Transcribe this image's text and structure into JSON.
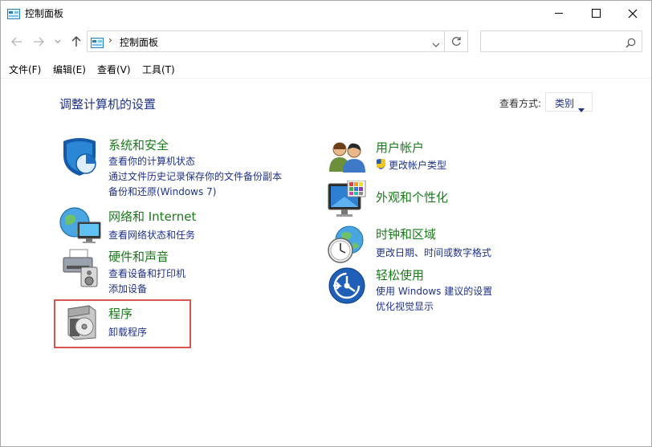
{
  "window": {
    "title": "控制面板",
    "controls": {
      "minimize": "—",
      "maximize": "☐",
      "close": "✕"
    }
  },
  "address": {
    "separator": "›",
    "path": "控制面板",
    "search_placeholder": ""
  },
  "menu": [
    {
      "label": "文件(F)"
    },
    {
      "label": "编辑(E)"
    },
    {
      "label": "查看(V)"
    },
    {
      "label": "工具(T)"
    }
  ],
  "main": {
    "heading": "调整计算机的设置",
    "view_by_label": "查看方式:",
    "view_by_value": "类别"
  },
  "categories": {
    "system": {
      "title": "系统和安全",
      "links": [
        "查看你的计算机状态",
        "通过文件历史记录保存你的文件备份副本",
        "备份和还原(Windows 7)"
      ]
    },
    "network": {
      "title": "网络和 Internet",
      "links": [
        "查看网络状态和任务"
      ]
    },
    "hardware": {
      "title": "硬件和声音",
      "links": [
        "查看设备和打印机",
        "添加设备"
      ]
    },
    "programs": {
      "title": "程序",
      "links": [
        "卸载程序"
      ]
    },
    "user": {
      "title": "用户帐户",
      "links": [
        "更改帐户类型"
      ]
    },
    "appearance": {
      "title": "外观和个性化",
      "links": []
    },
    "clock": {
      "title": "时钟和区域",
      "links": [
        "更改日期、时间或数字格式"
      ]
    },
    "ease": {
      "title": "轻松使用",
      "links": [
        "使用 Windows 建议的设置",
        "优化视觉显示"
      ]
    }
  },
  "colors": {
    "category_title": "#1a7a1a",
    "link": "#1e3287",
    "highlight_border": "#d9534f"
  }
}
